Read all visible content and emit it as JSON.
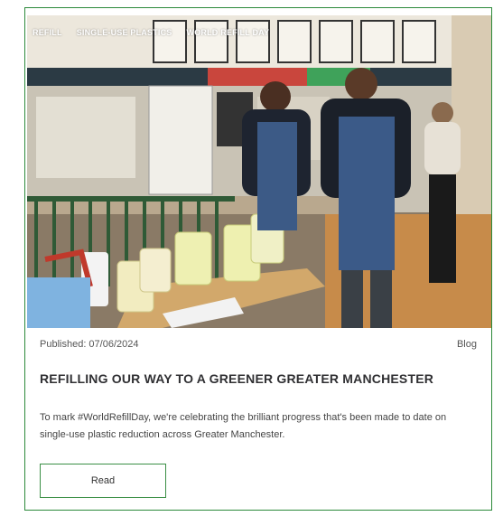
{
  "card": {
    "tags": [
      "Refill",
      "Single-use plastics",
      "World Refill Day"
    ],
    "published": "Published: 07/06/2024",
    "category": "Blog",
    "title": "REFILLING OUR WAY TO A GREENER GREATER MANCHESTER",
    "excerpt": "To mark #WorldRefillDay, we're celebrating the brilliant progress that's been made to date on single-use plastic reduction across Greater Manchester.",
    "read_label": "Read",
    "accent_color": "#2c8a3a"
  }
}
